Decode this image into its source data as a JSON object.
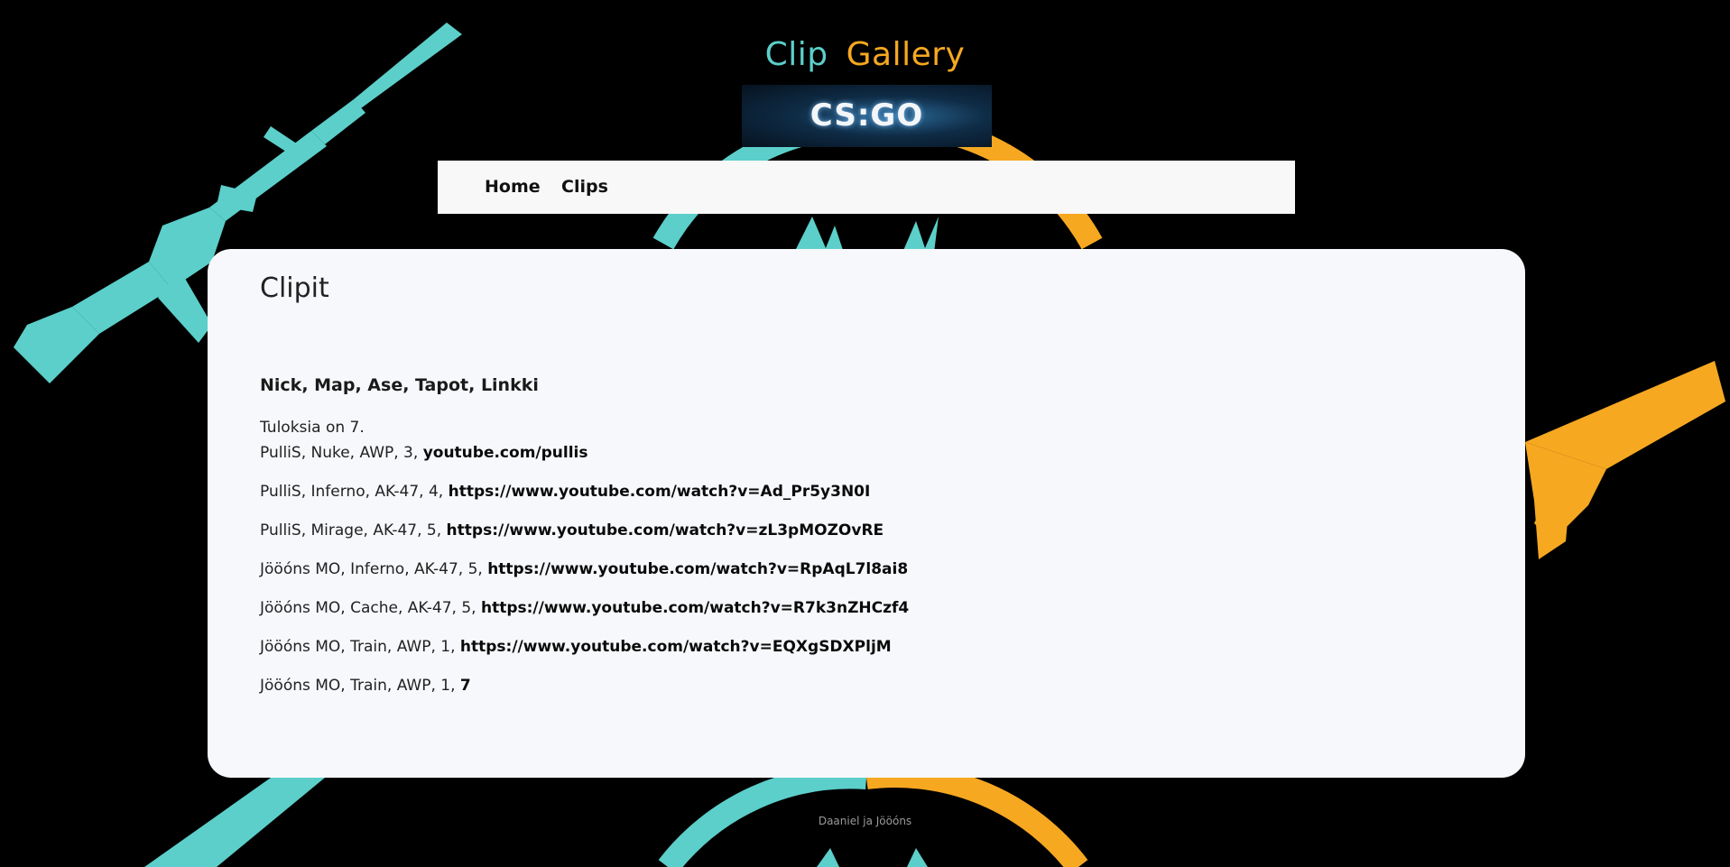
{
  "header": {
    "title_word1": "Clip",
    "title_word2": "Gallery",
    "logo_text": "CS:GO"
  },
  "nav": {
    "home": "Home",
    "clips": "Clips"
  },
  "main": {
    "title": "Clipit",
    "columns_heading": "Nick, Map, Ase, Tapot, Linkki",
    "result_count": "Tuloksia on 7.",
    "clips": [
      {
        "details": "PulliS, Nuke, AWP, 3, ",
        "link": "youtube.com/pullis"
      },
      {
        "details": "PulliS, Inferno, AK-47, 4, ",
        "link": "https://www.youtube.com/watch?v=Ad_Pr5y3N0I"
      },
      {
        "details": "PulliS, Mirage, AK-47, 5, ",
        "link": "https://www.youtube.com/watch?v=zL3pMOZOvRE"
      },
      {
        "details": "Jööóns MO, Inferno, AK-47, 5, ",
        "link": "https://www.youtube.com/watch?v=RpAqL7l8ai8"
      },
      {
        "details": "Jööóns MO, Cache, AK-47, 5, ",
        "link": "https://www.youtube.com/watch?v=R7k3nZHCzf4"
      },
      {
        "details": "Jööóns MO, Train, AWP, 1, ",
        "link": "https://www.youtube.com/watch?v=EQXgSDXPljM"
      },
      {
        "details": "Jööóns MO, Train, AWP, 1, ",
        "link": "7"
      }
    ]
  },
  "footer": {
    "text": "Daaniel ja Jööóns"
  },
  "colors": {
    "teal": "#5ccfca",
    "orange": "#f6a821",
    "background": "#000000"
  },
  "icons": [
    "m4-rifle-icon",
    "ak47-rifle-icon",
    "csgo-emblem-ring"
  ]
}
